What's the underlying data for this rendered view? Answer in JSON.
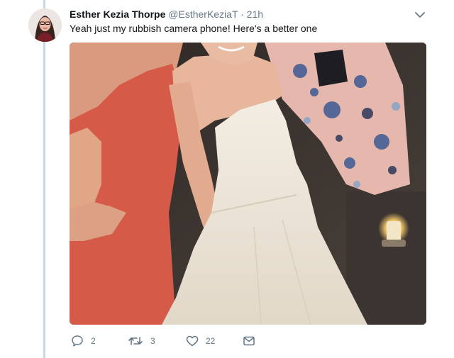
{
  "tweet": {
    "author_name": "Esther Kezia Thorpe",
    "author_handle": "@EstherKeziaT",
    "separator": "·",
    "timestamp": "21h",
    "text": "Yeah just my rubbish camera phone! Here's a better one",
    "image_alt": "Photo of two women posing together at a wedding, one in a coral dress and one in a white strapless gown",
    "actions": {
      "reply_count": "2",
      "retweet_count": "3",
      "like_count": "22"
    }
  },
  "icons": {
    "reply": "reply-icon",
    "retweet": "retweet-icon",
    "like": "heart-icon",
    "dm": "envelope-icon",
    "menu": "chevron-down-icon"
  },
  "colors": {
    "text": "#14171a",
    "muted": "#657786",
    "thread_line": "#c4d8ea"
  }
}
